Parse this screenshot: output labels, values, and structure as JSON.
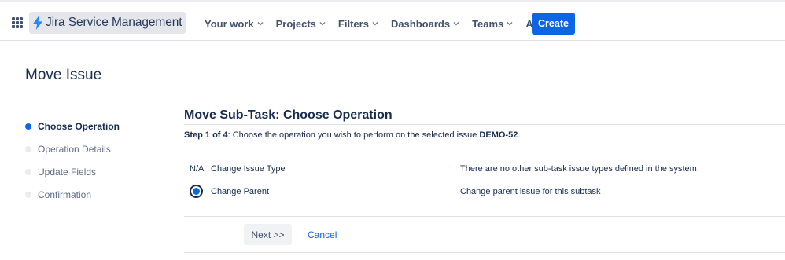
{
  "app": {
    "name": "Jira Service Management"
  },
  "nav": {
    "items": [
      {
        "label": "Your work"
      },
      {
        "label": "Projects"
      },
      {
        "label": "Filters"
      },
      {
        "label": "Dashboards"
      },
      {
        "label": "Teams"
      },
      {
        "label": "Apps"
      }
    ],
    "create_label": "Create"
  },
  "page": {
    "title": "Move Issue"
  },
  "steps": [
    {
      "label": "Choose Operation",
      "active": true
    },
    {
      "label": "Operation Details",
      "active": false
    },
    {
      "label": "Update Fields",
      "active": false
    },
    {
      "label": "Confirmation",
      "active": false
    }
  ],
  "form": {
    "section_title": "Move Sub-Task: Choose Operation",
    "step_label": "Step 1 of 4",
    "step_text": ": Choose the operation you wish to perform on the selected issue ",
    "issue_key": "DEMO-52",
    "step_end": ".",
    "operations": [
      {
        "marker": "N/A",
        "name": "Change Issue Type",
        "description": "There are no other sub-task issue types defined in the system."
      },
      {
        "marker": "selected",
        "name": "Change Parent",
        "description": "Change parent issue for this subtask"
      }
    ],
    "next_label": "Next >>",
    "cancel_label": "Cancel"
  },
  "colors": {
    "primary": "#0c66e4",
    "text": "#172b4d",
    "muted": "#5e6c84"
  }
}
